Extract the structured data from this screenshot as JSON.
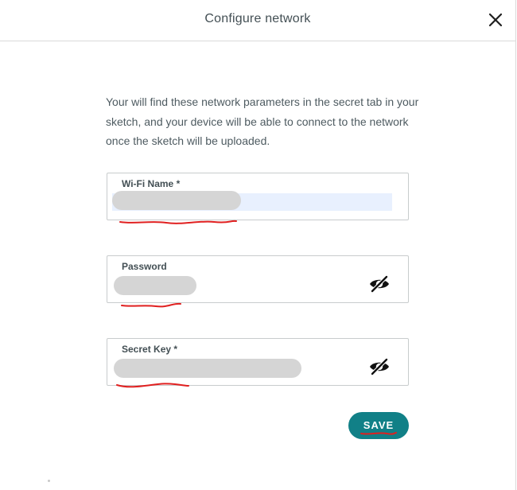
{
  "dialog": {
    "title": "Configure network",
    "description": "Your will find these network parameters in the secret tab in your sketch, and your device will be able to connect to the network once the sketch will be uploaded."
  },
  "fields": {
    "wifi_name": {
      "label": "Wi-Fi Name *",
      "value": ""
    },
    "password": {
      "label": "Password",
      "value": ""
    },
    "secret_key": {
      "label": "Secret Key *",
      "value": ""
    }
  },
  "actions": {
    "save_label": "SAVE"
  },
  "colors": {
    "accent": "#118087",
    "annotation": "#e02020",
    "autofill_bg": "#e8f0fe"
  },
  "icons": {
    "close": "close-icon",
    "visibility": "eye-off-icon"
  }
}
